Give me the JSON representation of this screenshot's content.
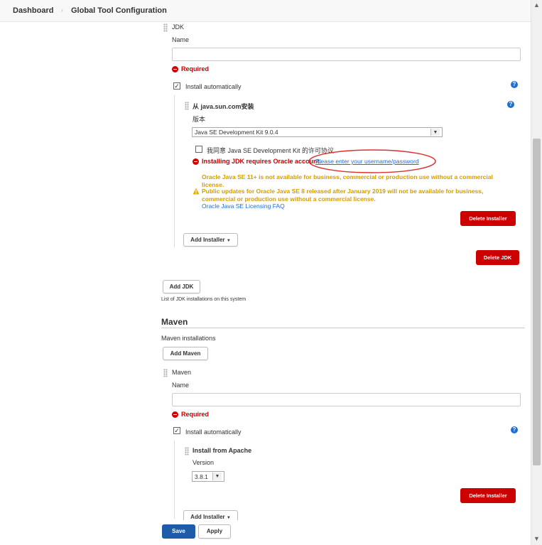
{
  "breadcrumb": {
    "home": "Dashboard",
    "current": "Global Tool Configuration"
  },
  "jdk": {
    "section_title": "JDK",
    "name_label": "Name",
    "name_value": "",
    "required": "Required",
    "install_auto_label": "Install automatically",
    "installer": {
      "title": "从 java.sun.com安装",
      "version_label": "版本",
      "version_value": "Java SE Development Kit 9.0.4",
      "agree_label": "我同意 Java SE Development Kit 的许可协议",
      "error_text": "Installing JDK requires Oracle account.",
      "error_link": "Please enter your username/password",
      "warning_line1": "Oracle Java SE 11+ is not available for business, commercial or production use without a commercial license.",
      "warning_line2": "Public updates for Oracle Java SE 8 released after January 2019 will not be available for business, commercial or production use without a commercial license.",
      "faq_link": "Oracle Java SE Licensing FAQ",
      "delete_installer": "Delete Installer"
    },
    "add_installer": "Add Installer",
    "delete_jdk": "Delete JDK",
    "add_jdk": "Add JDK",
    "list_caption": "List of JDK installations on this system"
  },
  "maven": {
    "heading": "Maven",
    "installations_label": "Maven installations",
    "add_maven": "Add Maven",
    "section_title": "Maven",
    "name_label": "Name",
    "name_value": "",
    "required": "Required",
    "install_auto_label": "Install automatically",
    "installer": {
      "title": "Install from Apache",
      "version_label": "Version",
      "version_value": "3.8.1",
      "delete_installer": "Delete Installer"
    },
    "add_installer": "Add Installer"
  },
  "footer": {
    "save": "Save",
    "apply": "Apply"
  },
  "colors": {
    "danger": "#cc0000",
    "warning": "#d39e00",
    "link": "#1e6ed4",
    "primary": "#1e5ba8",
    "annotation": "#e03030"
  },
  "icons": {
    "required": "minus-circle-icon",
    "help": "question-circle-icon",
    "warning": "warning-triangle-icon",
    "dropdown": "chevron-down-icon"
  }
}
